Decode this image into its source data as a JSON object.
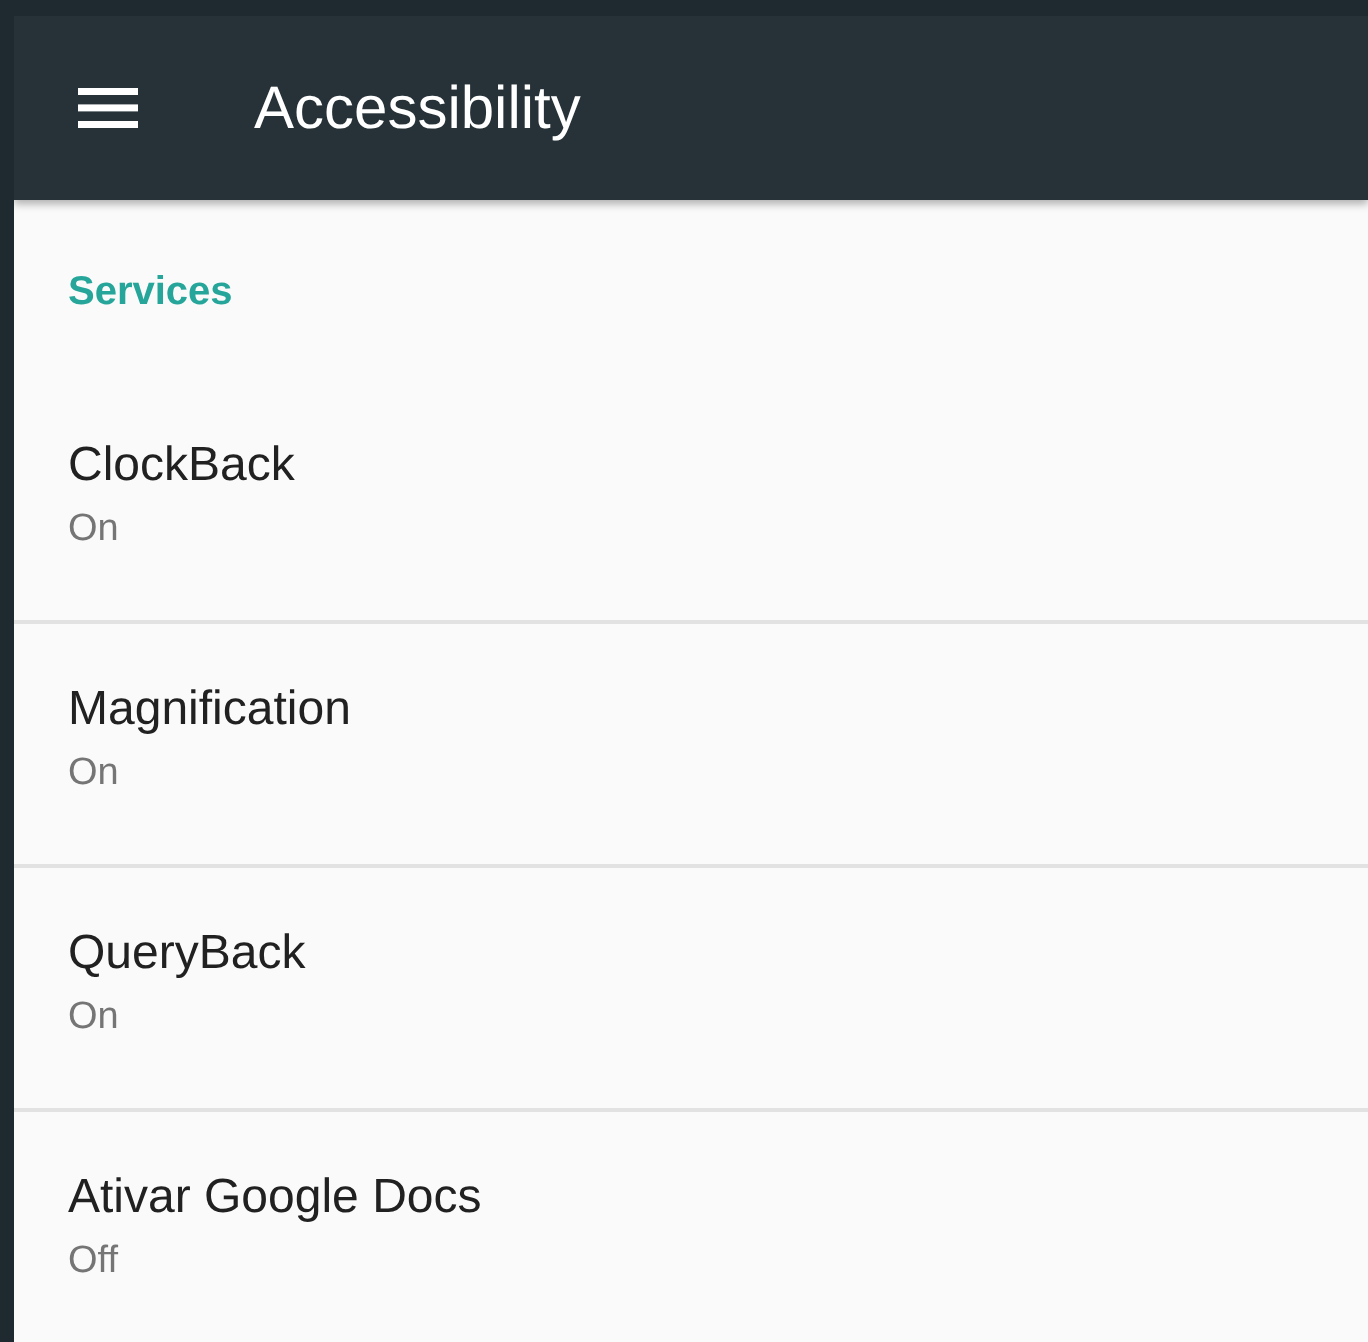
{
  "app_bar": {
    "title": "Accessibility"
  },
  "section": {
    "title": "Services"
  },
  "items": [
    {
      "title": "ClockBack",
      "summary": "On"
    },
    {
      "title": "Magnification",
      "summary": "On"
    },
    {
      "title": "QueryBack",
      "summary": "On"
    },
    {
      "title": "Ativar Google Docs",
      "summary": "Off"
    }
  ]
}
